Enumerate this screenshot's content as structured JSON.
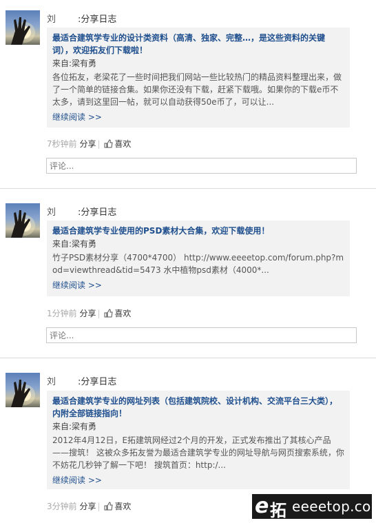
{
  "posts": [
    {
      "author": "刘",
      "action": ":分享日志",
      "title": "最适合建筑学专业的设计类资料（高清、独家、完整…，是这些资料的关键词），欢迎拓友们下载啦！",
      "from_label": "来自:",
      "from_name": "梁有勇",
      "body": "各位拓友，老梁花了一些时间把我们网站一些比较热门的精品资料整理出来，做了一个简单的链接合集。如果你还没有下载，赶紧下载哦。如果你的下载e币不太多，请到这里回一帖，就可以自动获得50e币了，可以让...",
      "more": "继续阅读 >>",
      "time": "7秒钟前",
      "share": "分享",
      "like": "喜欢",
      "comment_placeholder": "评论..."
    },
    {
      "author": "刘",
      "action": ":分享日志",
      "title": "最适合建筑学专业使用的PSD素材大合集，欢迎下载使用！",
      "from_label": "来自:",
      "from_name": "梁有勇",
      "body": "竹子PSD素材分享（4700*4700） http://www.eeeetop.com/forum.php?mod=viewthread&tid=5473 水中植物psd素材（4000*...",
      "more": "继续阅读 >>",
      "time": "1分钟前",
      "share": "分享",
      "like": "喜欢",
      "comment_placeholder": "评论..."
    },
    {
      "author": "刘",
      "action": ":分享日志",
      "title": "最适合建筑学专业的网址列表（包括建筑院校、设计机构、交流平台三大类），内附全部链接指向！",
      "from_label": "来自:",
      "from_name": "梁有勇",
      "body": "2012年4月12日，E拓建筑网经过2个月的开发，正式发布推出了其核心产品——搜筑！ 这被众多拓友誉为最适合建筑学专业的网址导航与网页搜索系统，你不妨花几秒钟了解一下吧！ 搜筑首页：http:/...",
      "more": "继续阅读 >>",
      "time": "3分钟前",
      "share": "分享",
      "like": "喜欢"
    }
  ],
  "watermark": {
    "e": "e",
    "cn": "拓",
    "domain": "eeeetop.com"
  }
}
